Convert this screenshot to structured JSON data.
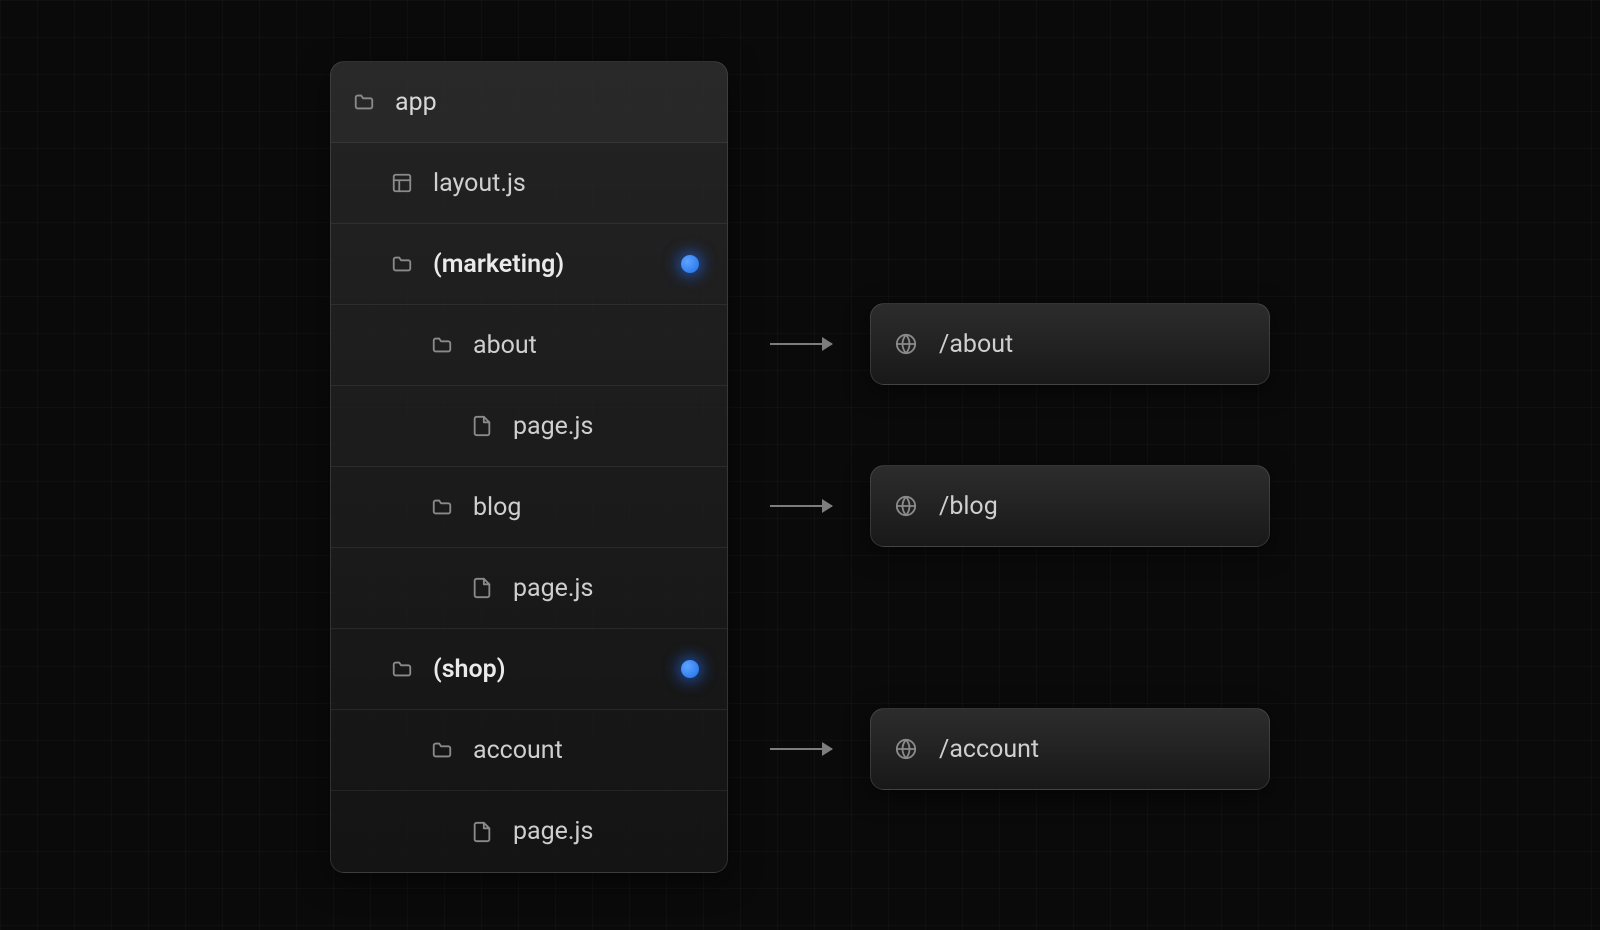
{
  "tree": {
    "root": {
      "label": "app",
      "icon": "folder"
    },
    "rows": [
      {
        "label": "layout.js",
        "icon": "layout",
        "indent": 1,
        "bold": false,
        "dot": false
      },
      {
        "label": "(marketing)",
        "icon": "folder",
        "indent": 1,
        "bold": true,
        "dot": true
      },
      {
        "label": "about",
        "icon": "folder",
        "indent": 2,
        "bold": false,
        "dot": false
      },
      {
        "label": "page.js",
        "icon": "file",
        "indent": 3,
        "bold": false,
        "dot": false
      },
      {
        "label": "blog",
        "icon": "folder",
        "indent": 2,
        "bold": false,
        "dot": false
      },
      {
        "label": "page.js",
        "icon": "file",
        "indent": 3,
        "bold": false,
        "dot": false
      },
      {
        "label": "(shop)",
        "icon": "folder",
        "indent": 1,
        "bold": true,
        "dot": true
      },
      {
        "label": "account",
        "icon": "folder",
        "indent": 2,
        "bold": false,
        "dot": false
      },
      {
        "label": "page.js",
        "icon": "file",
        "indent": 3,
        "bold": false,
        "dot": false
      }
    ]
  },
  "urls": [
    {
      "path": "/about"
    },
    {
      "path": "/blog"
    },
    {
      "path": "/account"
    }
  ]
}
